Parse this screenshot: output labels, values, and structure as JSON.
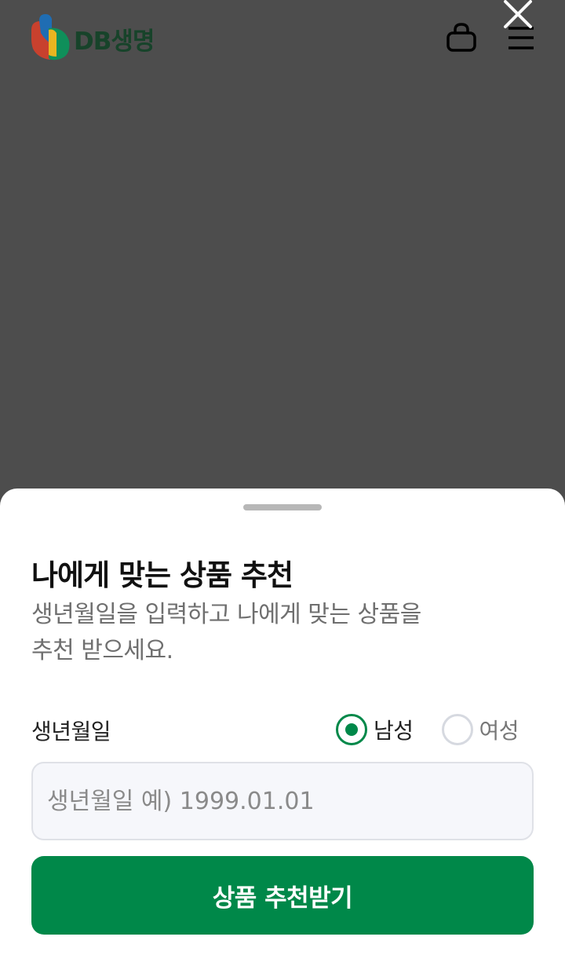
{
  "header": {
    "logo_text": "DB생명",
    "cart_icon": "shopping-bag-icon",
    "menu_icon": "hamburger-menu-icon",
    "close_icon": "close-icon"
  },
  "sheet": {
    "title": "나에게 맞는 상품 추천",
    "description_line1": "생년월일을 입력하고 나에게 맞는 상품을",
    "description_line2": "추천 받으세요.",
    "birth_label": "생년월일",
    "gender": {
      "male_label": "남성",
      "female_label": "여성",
      "selected": "남성"
    },
    "birth_input": {
      "value": "",
      "placeholder": "생년월일 예) 1999.01.01"
    },
    "submit_label": "상품 추천받기"
  },
  "colors": {
    "brand_green": "#008849",
    "overlay": "#4d4d4d",
    "logo_text": "#17432a"
  }
}
